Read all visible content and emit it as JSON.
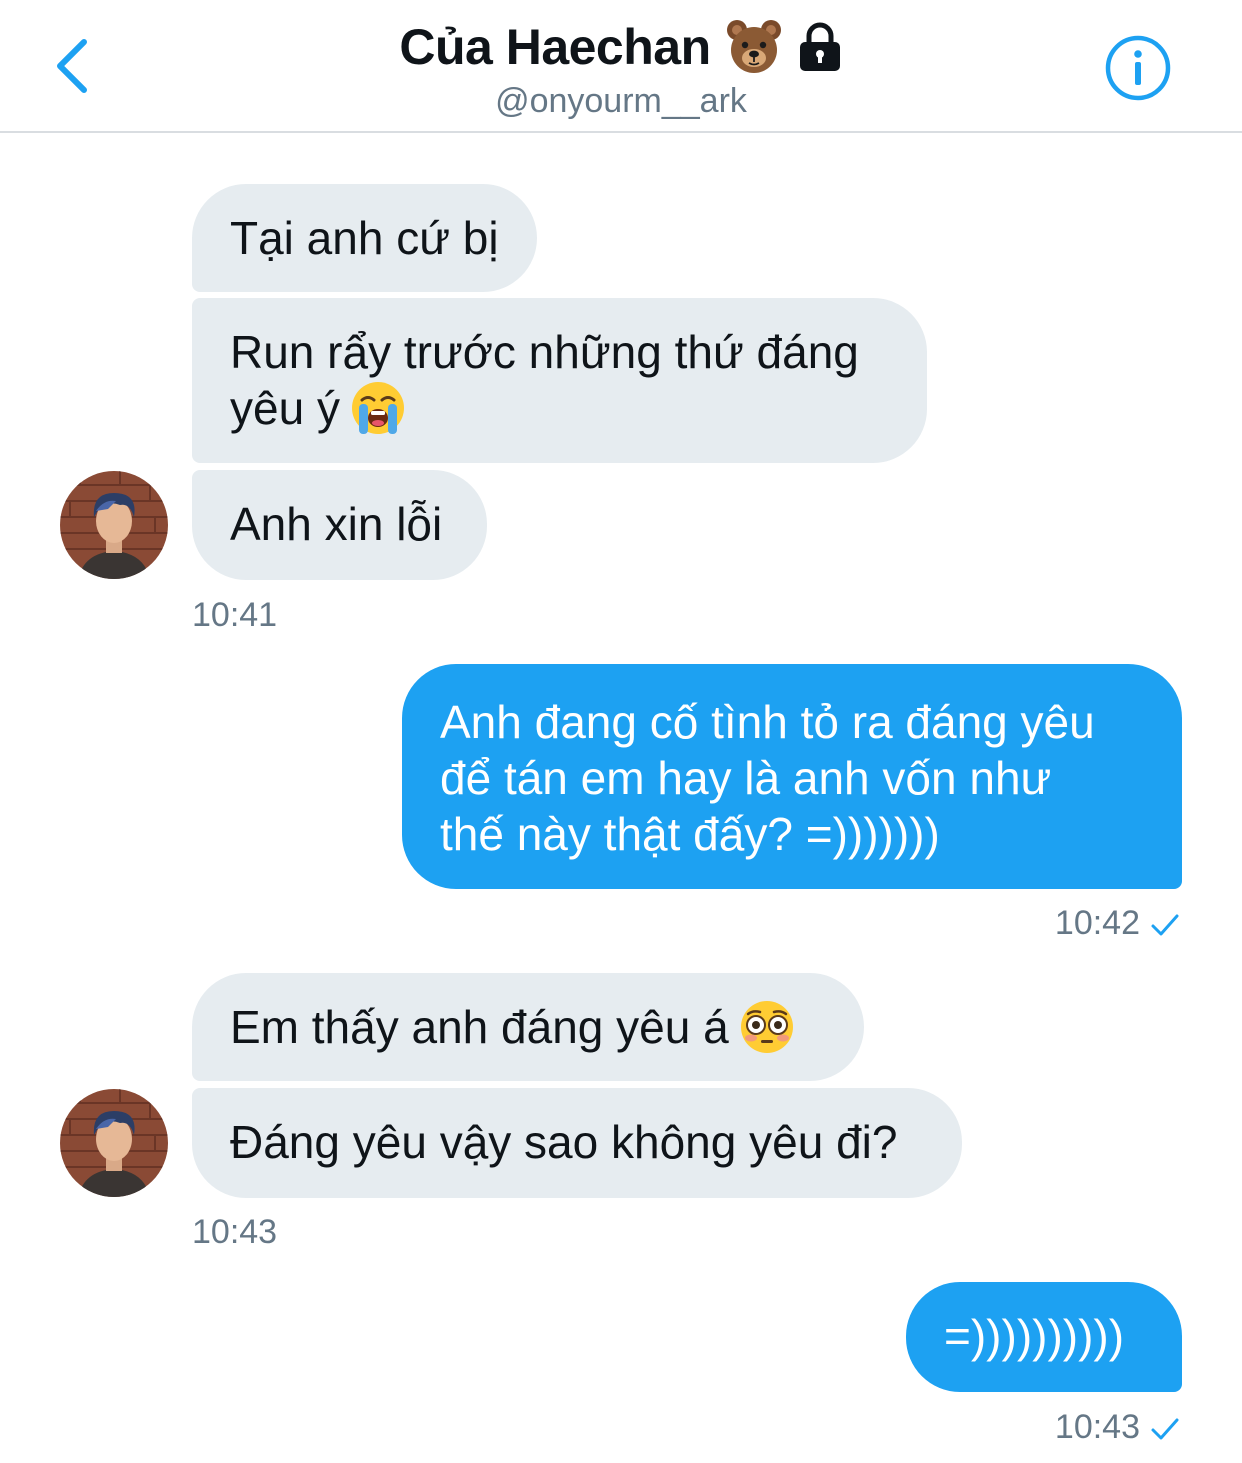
{
  "header": {
    "title": "Của Haechan",
    "handle": "@onyourm__ark",
    "title_icons": [
      "bear-face-icon",
      "lock-icon"
    ],
    "back_icon": "chevron-left-icon",
    "info_icon": "info-circle-icon"
  },
  "colors": {
    "accent": "#1da1f2",
    "incoming_bubble": "#e6ecf0",
    "timestamp": "#657786"
  },
  "messages": [
    {
      "dir": "in",
      "text": "Tại anh cứ bị"
    },
    {
      "dir": "in",
      "text": "Run rẩy trước những thứ đáng",
      "text2": "yêu ý",
      "emoji": "loudly-crying-face-icon"
    },
    {
      "dir": "in",
      "text": "Anh xin lỗi"
    },
    {
      "dir": "time_in",
      "text": "10:41"
    },
    {
      "dir": "out",
      "lines": [
        "Anh đang cố tình tỏ ra đáng yêu",
        "để tán em hay là anh vốn như",
        "thế này thật đấy? =)))))))"
      ]
    },
    {
      "dir": "time_out",
      "text": "10:42",
      "status_icon": "check-icon"
    },
    {
      "dir": "in",
      "text": "Em thấy anh đáng yêu á",
      "emoji": "flushed-face-icon"
    },
    {
      "dir": "in",
      "text": "Đáng yêu vậy sao không yêu đi?"
    },
    {
      "dir": "time_in",
      "text": "10:43"
    },
    {
      "dir": "out",
      "text": "=))))))))))"
    },
    {
      "dir": "time_out",
      "text": "10:43",
      "status_icon": "check-icon"
    }
  ]
}
